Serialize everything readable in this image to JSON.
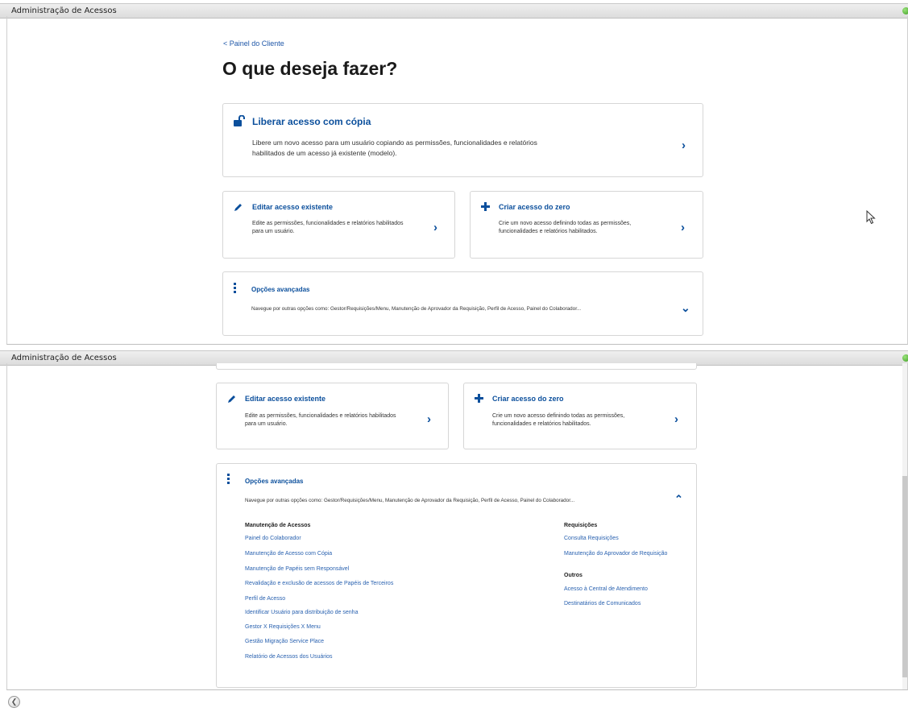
{
  "panel1": {
    "header": "Administração de Acessos",
    "back_link": "< Painel do Cliente",
    "title": "O que deseja fazer?",
    "copy_card": {
      "title": "Liberar acesso com cópia",
      "desc_line1": "Libere um novo acesso para um usuário copiando as permissões, funcionalidades e relatórios",
      "desc_line2": "habilitados de um acesso já existente (modelo).",
      "icon": "unlock-icon",
      "chevron": "›"
    },
    "edit_card": {
      "title": "Editar acesso existente",
      "desc_line1": "Edite as permissões, funcionalidades e relatórios habilitados",
      "desc_line2": "para um usuário.",
      "icon": "pencil-icon",
      "chevron": "›"
    },
    "create_card": {
      "title": "Criar acesso do zero",
      "desc_line1": "Crie um novo acesso definindo todas as permissões,",
      "desc_line2": "funcionalidades e relatórios habilitados.",
      "icon": "plus-icon",
      "chevron": "›"
    },
    "advanced_card": {
      "title": "Opções avançadas",
      "desc": "Navegue por outras opções como: Gestor/Requisições/Menu, Manutenção de Aprovador da Requisição, Perfil de Acesso, Painel do Colaborador...",
      "icon": "vertical-dots-icon",
      "chevron": "⌄"
    }
  },
  "panel2": {
    "header": "Administração de Acessos",
    "edit_card": {
      "title": "Editar acesso existente",
      "desc_line1": "Edite as permissões, funcionalidades e relatórios habilitados",
      "desc_line2": "para um usuário.",
      "chevron": "›"
    },
    "create_card": {
      "title": "Criar acesso do zero",
      "desc_line1": "Crie um novo acesso definindo todas as permissões,",
      "desc_line2": "funcionalidades e relatórios habilitados.",
      "chevron": "›"
    },
    "advanced_card": {
      "title": "Opções avançadas",
      "desc": "Navegue por outras opções como: Gestor/Requisições/Menu, Manutenção de Aprovador da Requisição, Perfil de Acesso, Painel do Colaborador...",
      "chevron": "⌃",
      "left_section": {
        "heading": "Manutenção de Acessos",
        "links": [
          "Painel do Colaborador",
          "Manutenção de Acesso com Cópia",
          "Manutenção de Papéis sem Responsável",
          "Revalidação e exclusão de acessos de Papéis de Terceiros",
          "Perfil de Acesso",
          "Identificar Usuário para distribuição de senha",
          "Gestor X Requisições X Menu",
          "Gestão Migração Service Place",
          "Relatório de Acessos dos Usuários"
        ]
      },
      "right_section_1": {
        "heading": "Requisições",
        "links": [
          "Consulta Requisições",
          "Manutenção do Aprovador de Requisição"
        ]
      },
      "right_section_2": {
        "heading": "Outros",
        "links": [
          "Acesso à Central de Atendimento",
          "Destinatários de Comunicados"
        ]
      }
    }
  },
  "bottom_button": {
    "icon": "back-arrow-icon",
    "glyph": "❮"
  }
}
